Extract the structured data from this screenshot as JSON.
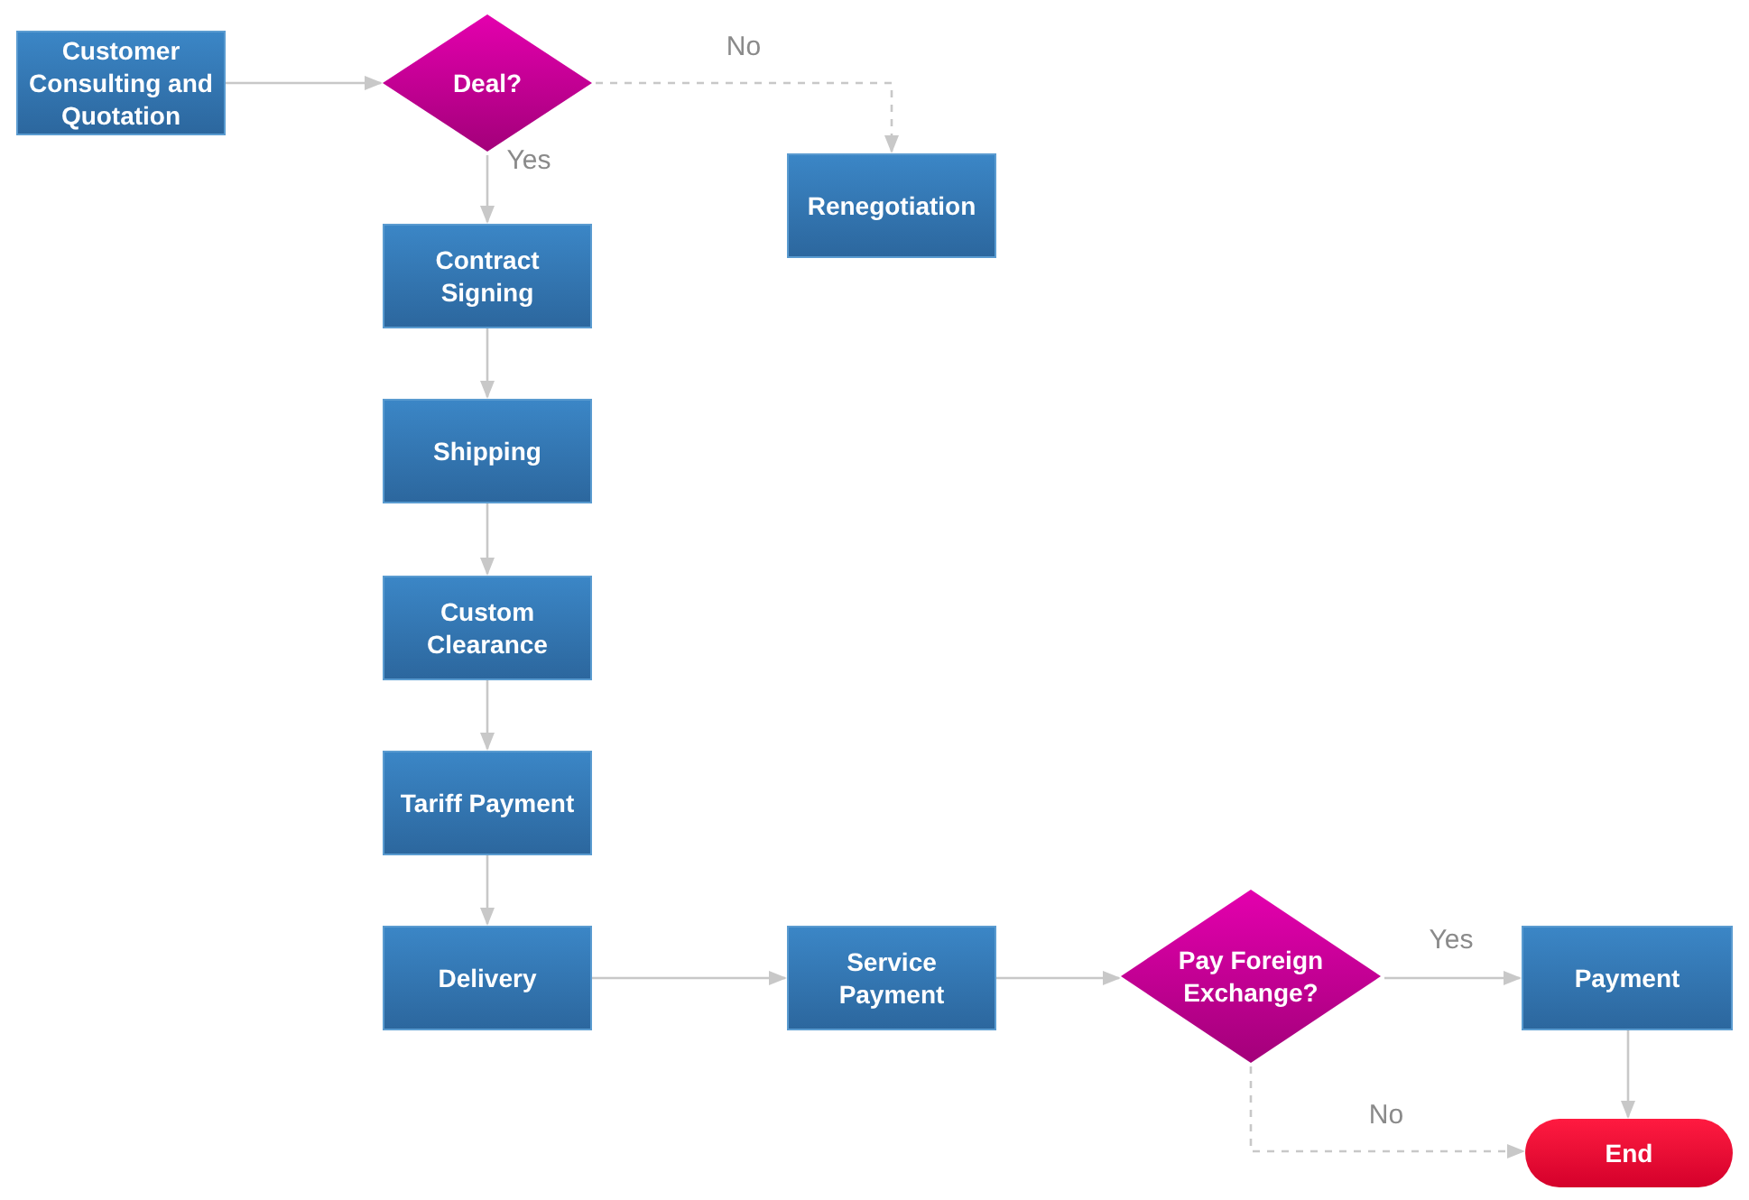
{
  "nodes": [
    {
      "kind": "process",
      "text": "Customer Consulting and Quotation"
    },
    {
      "kind": "decision",
      "text": "Deal?"
    },
    {
      "kind": "process",
      "text": "Renegotiation"
    },
    {
      "kind": "process",
      "text": "Contract Signing"
    },
    {
      "kind": "process",
      "text": "Shipping"
    },
    {
      "kind": "process",
      "text": "Custom Clearance"
    },
    {
      "kind": "process",
      "text": "Tariff Payment"
    },
    {
      "kind": "process",
      "text": "Delivery"
    },
    {
      "kind": "process",
      "text": "Service Payment"
    },
    {
      "kind": "decision",
      "text": "Pay Foreign Exchange?"
    },
    {
      "kind": "process",
      "text": "Payment"
    },
    {
      "kind": "terminator",
      "text": "End"
    }
  ],
  "edges": [
    {
      "kind": "solid"
    },
    {
      "kind": "dashed",
      "label": "No"
    },
    {
      "kind": "solid",
      "label": "Yes"
    },
    {
      "kind": "solid"
    },
    {
      "kind": "solid"
    },
    {
      "kind": "solid"
    },
    {
      "kind": "solid"
    },
    {
      "kind": "solid"
    },
    {
      "kind": "solid"
    },
    {
      "kind": "solid",
      "label": "Yes"
    },
    {
      "kind": "solid"
    },
    {
      "kind": "dashed",
      "label": "No"
    }
  ]
}
